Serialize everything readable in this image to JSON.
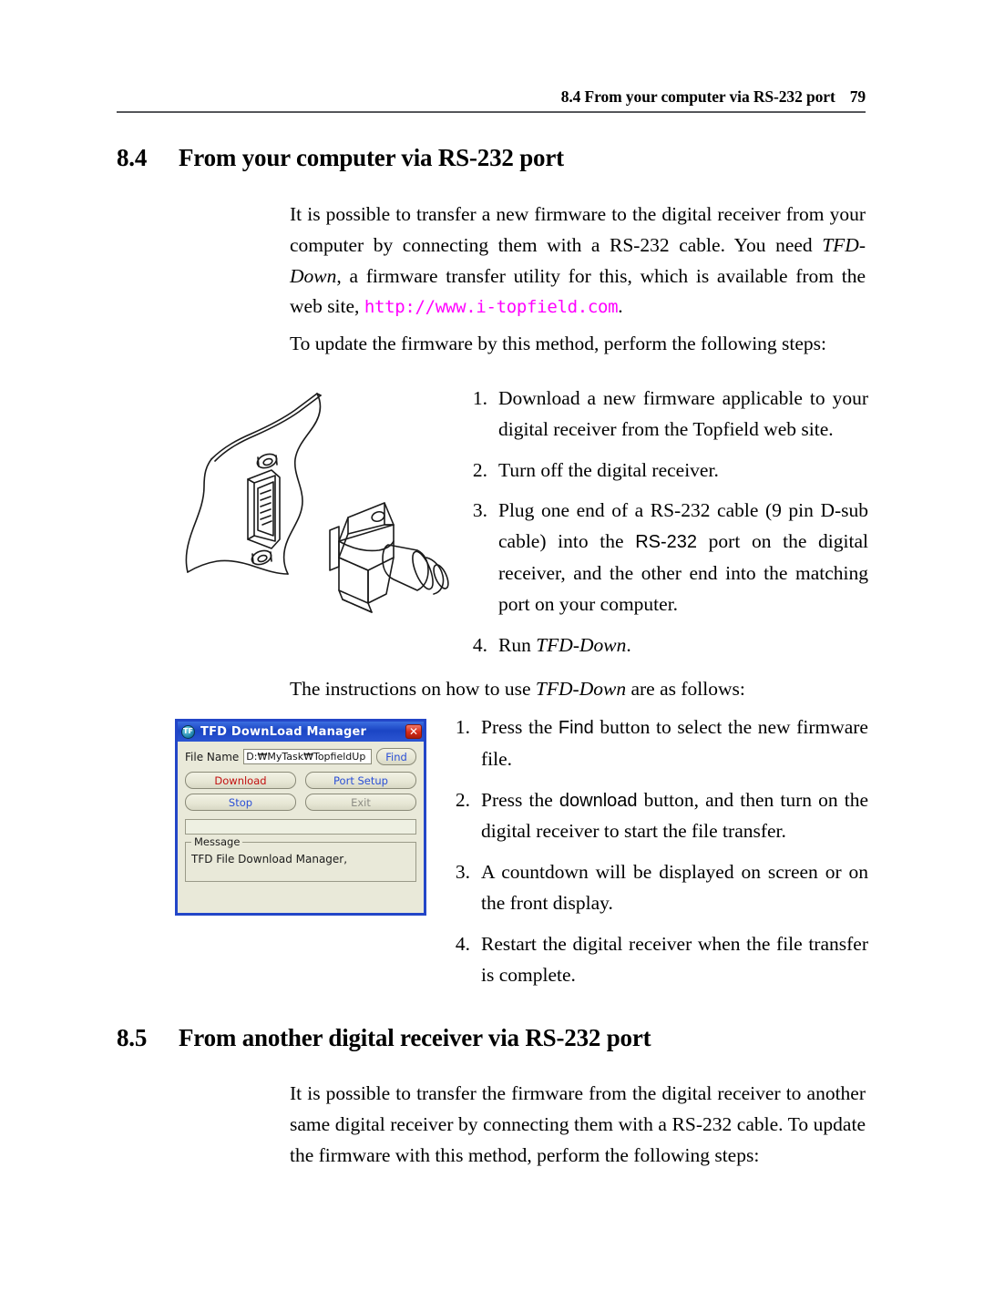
{
  "header": {
    "title": "8.4 From your computer via RS-232 port",
    "page_number": "79"
  },
  "section_84": {
    "number": "8.4",
    "title": "From your computer via RS-232 port",
    "para1_a": "It is possible to transfer a new firmware to the digital receiver from your computer by connecting them with a RS-232 cable. You need ",
    "para1_italic": "TFD-Down",
    "para1_b": ", a firmware transfer utility for this, which is available from the web site, ",
    "para1_url": "http://www.i-topfield.com",
    "para1_c": ".",
    "para2": "To update the firmware by this method, perform the following steps:",
    "steps": [
      {
        "marker": "1.",
        "text": "Download a new firmware applicable to your digital receiver from the Topfield web site."
      },
      {
        "marker": "2.",
        "text": "Turn off the digital receiver."
      },
      {
        "marker": "3.",
        "text_a": "Plug one end of a RS-232 cable (9 pin D-sub cable) into the ",
        "keyword": "RS-232",
        "text_b": " port on the digital receiver, and the other end into the matching port on your computer."
      },
      {
        "marker": "4.",
        "text_a": "Run ",
        "italic": "TFD-Down",
        "text_b": "."
      }
    ],
    "intro_instructions_a": "The instructions on how to use ",
    "intro_instructions_italic": "TFD-Down",
    "intro_instructions_b": " are as follows:",
    "tfd_steps": [
      {
        "marker": "1.",
        "text_a": "Press the ",
        "keyword": "Find",
        "text_b": " button to select the new firmware file."
      },
      {
        "marker": "2.",
        "text_a": "Press the ",
        "keyword": "download",
        "text_b": " button, and then turn on the digital receiver to start the file transfer."
      },
      {
        "marker": "3.",
        "text_a": "A countdown will be displayed on screen or on the front display.",
        "keyword": "",
        "text_b": ""
      },
      {
        "marker": "4.",
        "text_a": "Restart the digital receiver when the file transfer is complete.",
        "keyword": "",
        "text_b": ""
      }
    ]
  },
  "section_85": {
    "number": "8.5",
    "title": "From another digital receiver via RS-232 port",
    "para1": "It is possible to transfer the firmware from the digital receiver to another same digital receiver by connecting them with a RS-232 cable. To update the firmware with this method, perform the following steps:"
  },
  "tfd_dialog": {
    "app_icon_text": "TF",
    "title": "TFD DownLoad Manager",
    "close_label": "✕",
    "filename_label": "File Name",
    "filename_value": "D:₩MyTask₩TopfieldUp",
    "find_button": "Find",
    "download_button": "Download",
    "port_setup_button": "Port Setup",
    "stop_button": "Stop",
    "exit_button": "Exit",
    "message_legend": "Message",
    "message_text": "TFD File Download Manager,",
    "colors": {
      "titlebar": "#1b45c4",
      "close": "#d62a18",
      "download_text": "#c21010",
      "blue_text": "#2b4fd6",
      "disabled_text": "#8d8d85",
      "face": "#e9e9d9",
      "border": "#2346c8"
    }
  },
  "illustration": {
    "name": "rs-232-connector-diagram",
    "description": "Line drawing of a panel-mounted 9-pin D-sub RS-232 port and a matching D-sub cable connector plug"
  }
}
